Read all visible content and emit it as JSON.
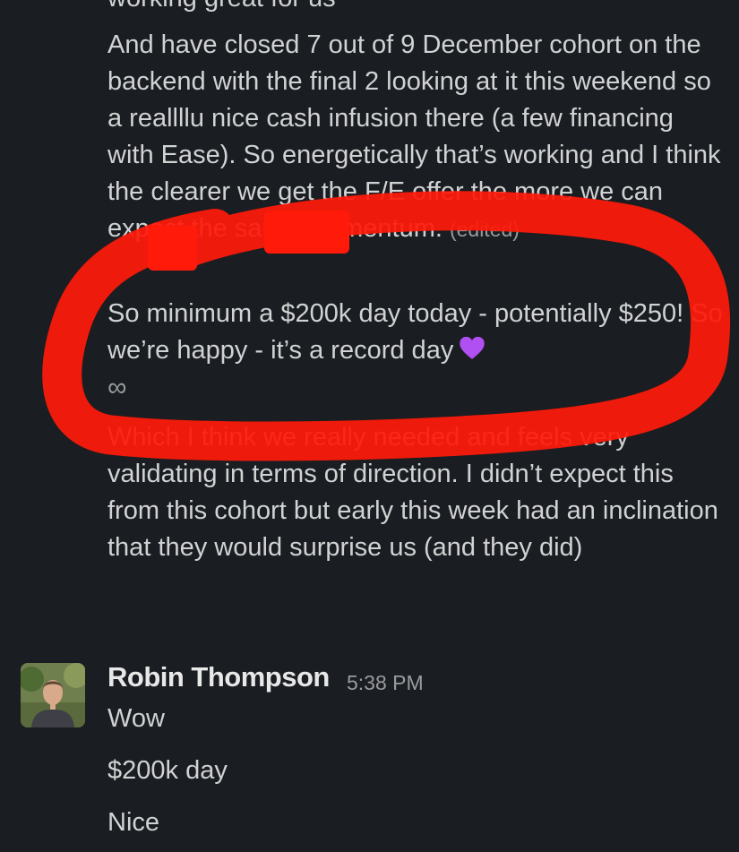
{
  "conversation": {
    "cut_off_line": "working great for us",
    "paragraphs": [
      "And have closed 7 out of 9 December cohort on the backend with the final 2 looking at it this weekend so a reallllu nice cash infusion there (a few financing with Ease). So energetically that’s working and I think the clearer we get the F/E offer the more we can expect the same momentum.",
      "So minimum a $200k day today - potentially $250! So we’re happy - it’s a record day",
      "Which I think we really needed and feels very validating in terms of direction. I didn’t expect this from this cohort but early this week had an inclination that they would surprise us (and they did)"
    ],
    "edited_label": "(edited)",
    "heart_emoji": "purple-heart-icon",
    "infinity_symbol": "∞"
  },
  "reply_message": {
    "sender_name": "Robin Thompson",
    "timestamp": "5:38 PM",
    "lines": [
      "Wow",
      "$200k day",
      "Nice"
    ]
  },
  "colors": {
    "background": "#1a1d21",
    "text": "#d1d2d3",
    "muted": "#9a9b9d",
    "annotation_red": "#ff1a0a",
    "heart": "#b04ff2"
  }
}
